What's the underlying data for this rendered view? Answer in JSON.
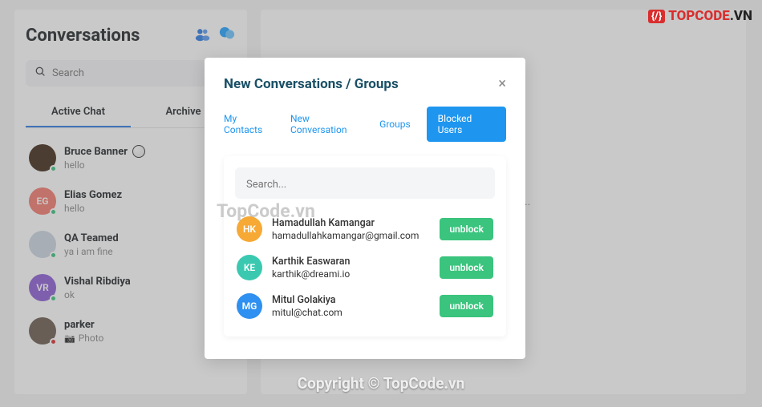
{
  "sidebar": {
    "title": "Conversations",
    "search_placeholder": "Search",
    "tabs": {
      "active": "Active Chat",
      "archive": "Archive"
    },
    "chats": [
      {
        "name": "Bruce Banner",
        "msg": "hello",
        "avatar_bg": "#333",
        "initials": "",
        "status": "online",
        "emoji": true
      },
      {
        "name": "Elias Gomez",
        "msg": "hello",
        "avatar_bg": "#f37a6e",
        "initials": "EG",
        "status": "online"
      },
      {
        "name": "QA Teamed",
        "msg": "ya i am fine",
        "avatar_bg": "#7aa9d4",
        "initials": "",
        "status": "online"
      },
      {
        "name": "Vishal Ribdiya",
        "msg": "ok",
        "avatar_bg": "#8c5cd4",
        "initials": "VR",
        "status": "online"
      },
      {
        "name": "parker",
        "msg": "Photo",
        "avatar_bg": "#888",
        "initials": "",
        "status": "offline",
        "photo": true
      }
    ]
  },
  "main": {
    "message": "ected yet..."
  },
  "modal": {
    "title": "New Conversations / Groups",
    "tabs": {
      "contacts": "My Contacts",
      "newconv": "New Conversation",
      "groups": "Groups",
      "blocked": "Blocked Users"
    },
    "search_placeholder": "Search...",
    "unblock_label": "unblock",
    "blocked": [
      {
        "name": "Hamadullah Kamangar",
        "email": "hamadullahkamangar@gmail.com",
        "initials": "HK",
        "bg": "#f6a935"
      },
      {
        "name": "Karthik Easwaran",
        "email": "karthik@dreami.io",
        "initials": "KE",
        "bg": "#3ac9b0"
      },
      {
        "name": "Mitul Golakiya",
        "email": "mitul@chat.com",
        "initials": "MG",
        "bg": "#2e90f0"
      }
    ]
  },
  "watermarks": {
    "top_brand": "TOPCODE",
    "top_suffix": ".VN",
    "mid": "TopCode.vn",
    "bottom": "Copyright © TopCode.vn"
  }
}
